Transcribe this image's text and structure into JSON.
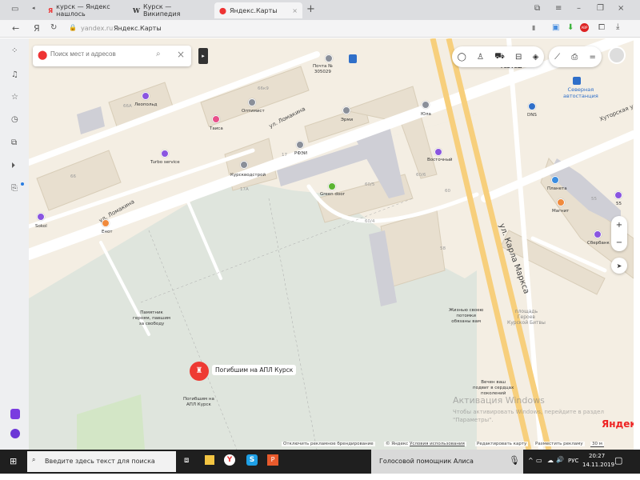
{
  "browser": {
    "tabs": [
      {
        "label": "курск — Яндекс нашлось",
        "icon": "yandex-icon"
      },
      {
        "label": "Курск — Википедия",
        "icon": "wikipedia-icon"
      },
      {
        "label": "Яндекс.Карты",
        "icon": "yandex-maps-pin-icon",
        "active": true
      }
    ],
    "new_tab": "+",
    "url_domain": "yandex.ru",
    "page_title": "Яндекс.Карты",
    "yandex_logo": "Я"
  },
  "search": {
    "placeholder": "Поиск мест и адресов"
  },
  "map": {
    "streets": [
      "ул. Ломакина",
      "ул. Ломакина",
      "ул. Карла Маркса",
      "Хуторская ул."
    ],
    "pois": [
      {
        "label": "Почта №\n305029",
        "color": "#8a8f99"
      },
      {
        "label": "Леопольд",
        "color": "#8a55e0"
      },
      {
        "label": "Оптимист",
        "color": "#8a8f99"
      },
      {
        "label": "Таиса",
        "color": "#e8508a"
      },
      {
        "label": "Эрми",
        "color": "#8a8f99"
      },
      {
        "label": "Юла",
        "color": "#8a8f99"
      },
      {
        "label": "РФЭИ",
        "color": "#8a8f99"
      },
      {
        "label": "Turbo service",
        "color": "#8a55e0"
      },
      {
        "label": "Курскводстрой",
        "color": "#8a8f99"
      },
      {
        "label": "Восточный",
        "color": "#8a55e0"
      },
      {
        "label": "Green door",
        "color": "#5bb431"
      },
      {
        "label": "Енот",
        "color": "#f08a3c"
      },
      {
        "label": "Sokol",
        "color": "#8a55e0"
      },
      {
        "label": "Северная\nавтостанция",
        "color": "#2f6fc9"
      },
      {
        "label": "DNS",
        "color": "#2f6fc9"
      },
      {
        "label": "Планета",
        "color": "#3b8de0"
      },
      {
        "label": "Магнит",
        "color": "#f08a3c"
      },
      {
        "label": "55",
        "color": "#8a55e0"
      },
      {
        "label": "Сбербанк",
        "color": "#8a55e0"
      },
      {
        "label": "Рив Гош",
        "color": "#8a8f99"
      }
    ],
    "house_numbers": [
      "66А",
      "66к9",
      "66",
      "17",
      "17А",
      "60/6",
      "60/5",
      "60/4",
      "60",
      "58",
      "55"
    ],
    "monuments": [
      "Памятник\nгероям, павшим\nза свободу",
      "Жизнью своею\nпотомки\nобязаны вам",
      "Вечен ваш\nподвиг в сердцах\nпоколений",
      "площадь\nГероев\nКурской Битвы",
      "Погибшим на\nАПЛ Курск"
    ],
    "selected_marker": "Погибшим на АПЛ Курск",
    "watermark_title": "Активация Windows",
    "watermark_text": "Чтобы активировать Windows, перейдите в раздел\n\"Параметры\".",
    "logo": "Яндекс",
    "footer": [
      "Отключить рекламное брендирование",
      "© Яндекс",
      "Условия использования",
      "Редактировать карту",
      "Разместить рекламу"
    ],
    "scale": "30 м",
    "zoom_in": "+",
    "zoom_out": "−"
  },
  "taskbar": {
    "search_placeholder": "Введите здесь текст для поиска",
    "alice": "Голосовой помощник Алиса",
    "lang": "РУС",
    "time": "20:27",
    "date": "14.11.2019"
  }
}
